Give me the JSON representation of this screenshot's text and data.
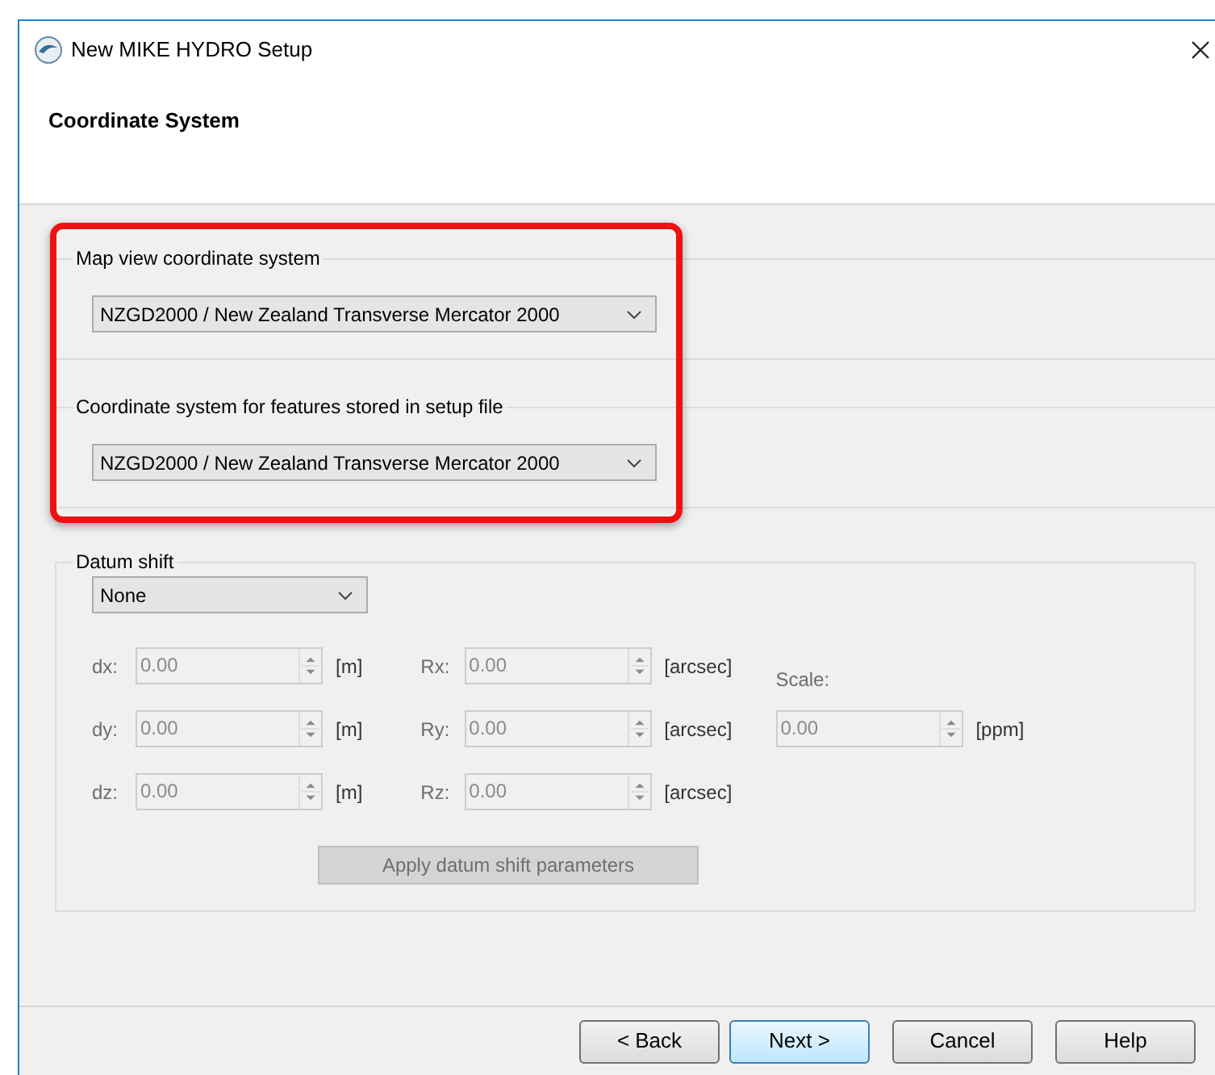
{
  "window": {
    "title": "New MIKE HYDRO Setup"
  },
  "page_title": "Coordinate System",
  "groups": [
    {
      "label": "Map view coordinate system",
      "value": "NZGD2000 / New Zealand Transverse Mercator 2000"
    },
    {
      "label": "Coordinate system for features stored in setup file",
      "value": "NZGD2000 / New Zealand Transverse Mercator 2000"
    }
  ],
  "datum_shift": {
    "label": "Datum shift",
    "method": "None",
    "rows": [
      [
        {
          "label": "dx:",
          "value": "0.00",
          "unit": "[m]",
          "disabled": true
        },
        {
          "label": "Rx:",
          "value": "0.00",
          "unit": "[arcsec]",
          "disabled": true
        }
      ],
      [
        {
          "label": "dy:",
          "value": "0.00",
          "unit": "[m]",
          "disabled": true
        },
        {
          "label": "Ry:",
          "value": "0.00",
          "unit": "[arcsec]",
          "disabled": true
        }
      ],
      [
        {
          "label": "dz:",
          "value": "0.00",
          "unit": "[m]",
          "disabled": true
        },
        {
          "label": "Rz:",
          "value": "0.00",
          "unit": "[arcsec]",
          "disabled": true
        }
      ]
    ],
    "scale": {
      "label": "Scale:",
      "value": "0.00",
      "unit": "[ppm]",
      "disabled": true
    },
    "apply_button": {
      "label": "Apply datum shift parameters",
      "disabled": true
    }
  },
  "buttons": [
    {
      "label": "< Back",
      "selected": false
    },
    {
      "label": "Next >",
      "selected": true
    },
    {
      "label": "Cancel",
      "selected": false
    },
    {
      "label": "Help",
      "selected": false
    }
  ]
}
